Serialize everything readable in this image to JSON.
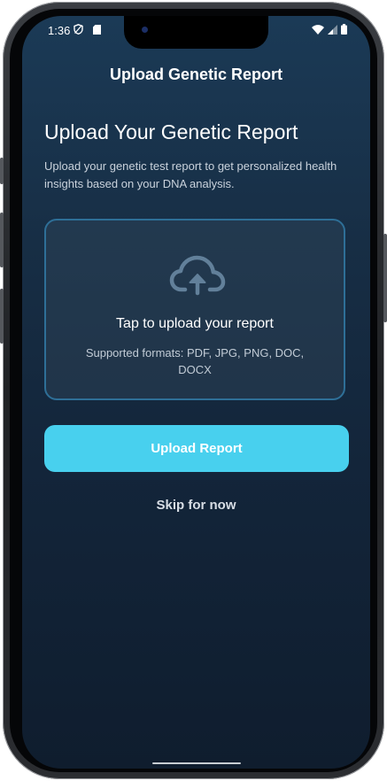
{
  "status_bar": {
    "time": "1:36"
  },
  "header": {
    "title": "Upload Genetic Report"
  },
  "main": {
    "title": "Upload Your Genetic Report",
    "description": "Upload your genetic test report to get personalized health insights based on your DNA analysis."
  },
  "upload_box": {
    "icon": "cloud-upload-icon",
    "title": "Tap to upload your report",
    "formats": "Supported formats: PDF, JPG, PNG, DOC, DOCX"
  },
  "actions": {
    "upload_label": "Upload Report",
    "skip_label": "Skip for now"
  },
  "colors": {
    "accent": "#48d0ee",
    "background_top": "#1b3a56",
    "background_bottom": "#0f1d2e",
    "box_border": "#2e6f97"
  }
}
